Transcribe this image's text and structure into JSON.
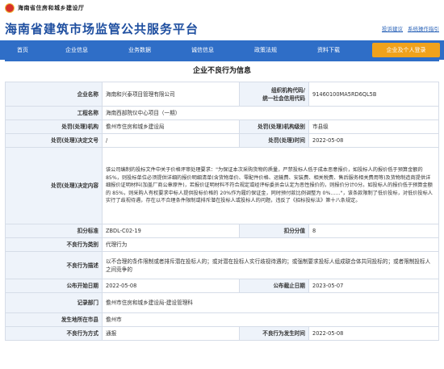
{
  "header": {
    "department": "海南省住房和城乡建设厅",
    "site_title": "海南省建筑市场监管公共服务平台",
    "links": [
      "投诉建议",
      "系统操作指引"
    ]
  },
  "nav": {
    "items": [
      "首页",
      "企业信息",
      "业务数据",
      "诚信信息",
      "政策法规",
      "资料下载"
    ],
    "cta": "企业及个人登录"
  },
  "page_title": "企业不良行为信息",
  "record": {
    "company_label": "企业名称",
    "company": "海南和兴泰项目管理有限公司",
    "org_code_label_1": "组织机构代码/",
    "org_code_label_2": "统一社会信用代码",
    "org_code": "91460100MA5RD6QL5B",
    "project_label": "工程名称",
    "project": "海南西部院仪中心项目（一期）",
    "agency_label": "处罚(处理)机构",
    "agency": "儋州市住房和城乡建设局",
    "agency_level_label": "处罚(处理)机构级别",
    "agency_level": "市县级",
    "doc_no_label": "处罚(处理)决定文号",
    "doc_no": "/",
    "decision_date_label": "处罚(处理)时间",
    "decision_date": "2022-05-08",
    "content_label": "处罚(处理)决定内容",
    "content": "该公司编制的投标文件中关于价格评审处理要求：\"为保证本次采购货物的质量，严禁投标人低于成本恶意报价，如投标人的报价低于预算金额的 85%，则投标单位必须提供详细的报价明细清单(含货物单价、零配件价格、运输费、安装费、相关税费、售后服务相关费用等)及货物制造商提供详细报价证明材料(加盖厂商公章原件)，若报价证明材料不符合规定或经评标委员会认定为恶性报价的，则报价分计0分。如投标人的报价低于预算金额的 85%，则采购人有权要求中标人提供投标价格的 20%作为履约保证金，同时预付款比例调整为 0%……\"，该条款限制了低价投标，对低价投标人实行了歧视待遇，存在以不合理条件限制或排斥潜在投标人或投标人的问题，违反了《招标投标法》第十八条规定。",
    "deduct_label": "扣分标准",
    "deduct": "ZBDL-C02-19",
    "score_label": "扣分分值",
    "score": "8",
    "behavior_type_label": "不良行为类别",
    "behavior_type": "代理行为",
    "behavior_desc_label": "不良行为描述",
    "behavior_desc": "以不合理的条件限制或者排斥潜在投标人的；或对潜在投标人实行歧视待遇的；或强制要求投标人组成联合体共同投标的；或者限制投标人之间竞争的",
    "publish_date_label": "公布开始日期",
    "publish_date": "2022-05-08",
    "publish_end_label": "公布截止日期",
    "publish_end": "2023-05-07",
    "record_agency_label": "记录部门",
    "record_agency": "儋州市住房和城乡建设局-建设管理科",
    "location_label": "发生地所在市县",
    "location": "儋州市",
    "method_label": "不良行为方式",
    "method": "通报",
    "occur_date_label": "不良行为发生时间",
    "occur_date": "2022-05-08"
  }
}
